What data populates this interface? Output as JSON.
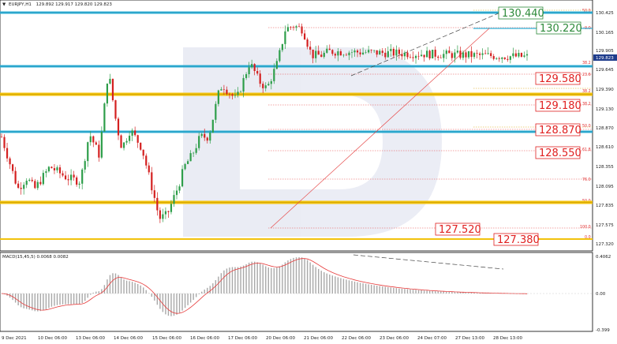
{
  "header": {
    "menu_glyph": "▼",
    "symbol": "EURJPY,H1",
    "ohlc": "129.892 129.917 129.820 129.823"
  },
  "macd_header": "MACD(15,45,5) 0.0068 0.0082",
  "current_price": "129.823",
  "price_ticks": [
    "130.425",
    "130.165",
    "129.905",
    "129.645",
    "129.390",
    "129.130",
    "128.870",
    "128.610",
    "128.355",
    "128.095",
    "127.835",
    "127.575",
    "127.320"
  ],
  "macd_ticks": [
    "0.4062",
    "0.00",
    "-0.399"
  ],
  "time_ticks": [
    "9 Dec 2021",
    "10 Dec 06:00",
    "13 Dec 06:00",
    "14 Dec 06:00",
    "15 Dec 06:00",
    "16 Dec 06:00",
    "17 Dec 06:00",
    "20 Dec 06:00",
    "21 Dec 06:00",
    "22 Dec 06:00",
    "23 Dec 06:00",
    "24 Dec 07:00",
    "27 Dec 13:00",
    "28 Dec 13:00"
  ],
  "level_labels": {
    "green": [
      "130.440",
      "130.220"
    ],
    "red": [
      "129.580",
      "129.180",
      "128.870",
      "128.550",
      "127.520",
      "127.380"
    ]
  },
  "fib_labels": [
    "50.0",
    "0.0",
    "38.2",
    "23.6",
    "38.2",
    "38.2",
    "50.0",
    "61.8",
    "76.0",
    "50.0",
    "100.0",
    "0.0"
  ],
  "colors": {
    "bull": "#2e9e4a",
    "bear": "#d42020",
    "blue_level": "#31b4d9",
    "yellow_level": "#f2c20c",
    "fib": "#e64a4a",
    "green_label": "#2d8a3a",
    "red_label": "#e02020",
    "price_box": "#1f3c8c"
  },
  "chart_data": {
    "type": "candlestick",
    "symbol": "EURJPY",
    "timeframe": "H1",
    "ylim": [
      127.32,
      130.425
    ],
    "horizontal_levels": [
      130.44,
      130.22,
      129.645,
      129.39,
      128.87,
      127.835,
      127.38
    ],
    "series": [
      {
        "x": [
          0,
          3.1,
          4.8,
          6.3,
          9.2,
          12.4,
          15,
          16.7,
          18.6,
          20.3,
          21.9,
          22.9,
          24.5,
          26.7,
          29.2,
          30,
          31.5,
          33.7,
          34.8,
          36.2,
          37.8,
          39.4,
          41.5,
          42.1,
          43.3,
          44.7,
          47.2,
          48,
          49,
          50.5,
          52.5,
          54,
          55.5,
          57.3,
          59,
          60.8,
          62.4,
          64,
          65.5,
          67.9,
          69.1,
          71.5,
          73.5,
          75,
          77,
          79,
          80.2,
          81.8,
          82.8,
          84.5,
          86.4,
          88.5,
          90.2,
          92.1,
          93.5,
          95.3,
          97.1,
          98.6,
          100
        ],
        "y": [
          128.75,
          128.05,
          128.2,
          128.05,
          128.35,
          128.2,
          128.15,
          128.8,
          128.5,
          129.65,
          128.9,
          128.6,
          128.85,
          128.6,
          127.9,
          127.65,
          127.7,
          128.1,
          128.35,
          128.5,
          128.75,
          128.75,
          129.4,
          129.45,
          129.35,
          129.25,
          129.75,
          129.65,
          129.5,
          129.4,
          129.75,
          130.2,
          130.25,
          130.2,
          129.85,
          129.85,
          129.9,
          129.9,
          129.83,
          129.83,
          129.83,
          129.83,
          129.83,
          129.83,
          129.83,
          129.83,
          129.83,
          129.83,
          129.83,
          129.83,
          129.83,
          129.83,
          129.83,
          129.83,
          129.83,
          129.83,
          129.83,
          129.83,
          129.83
        ]
      }
    ]
  }
}
